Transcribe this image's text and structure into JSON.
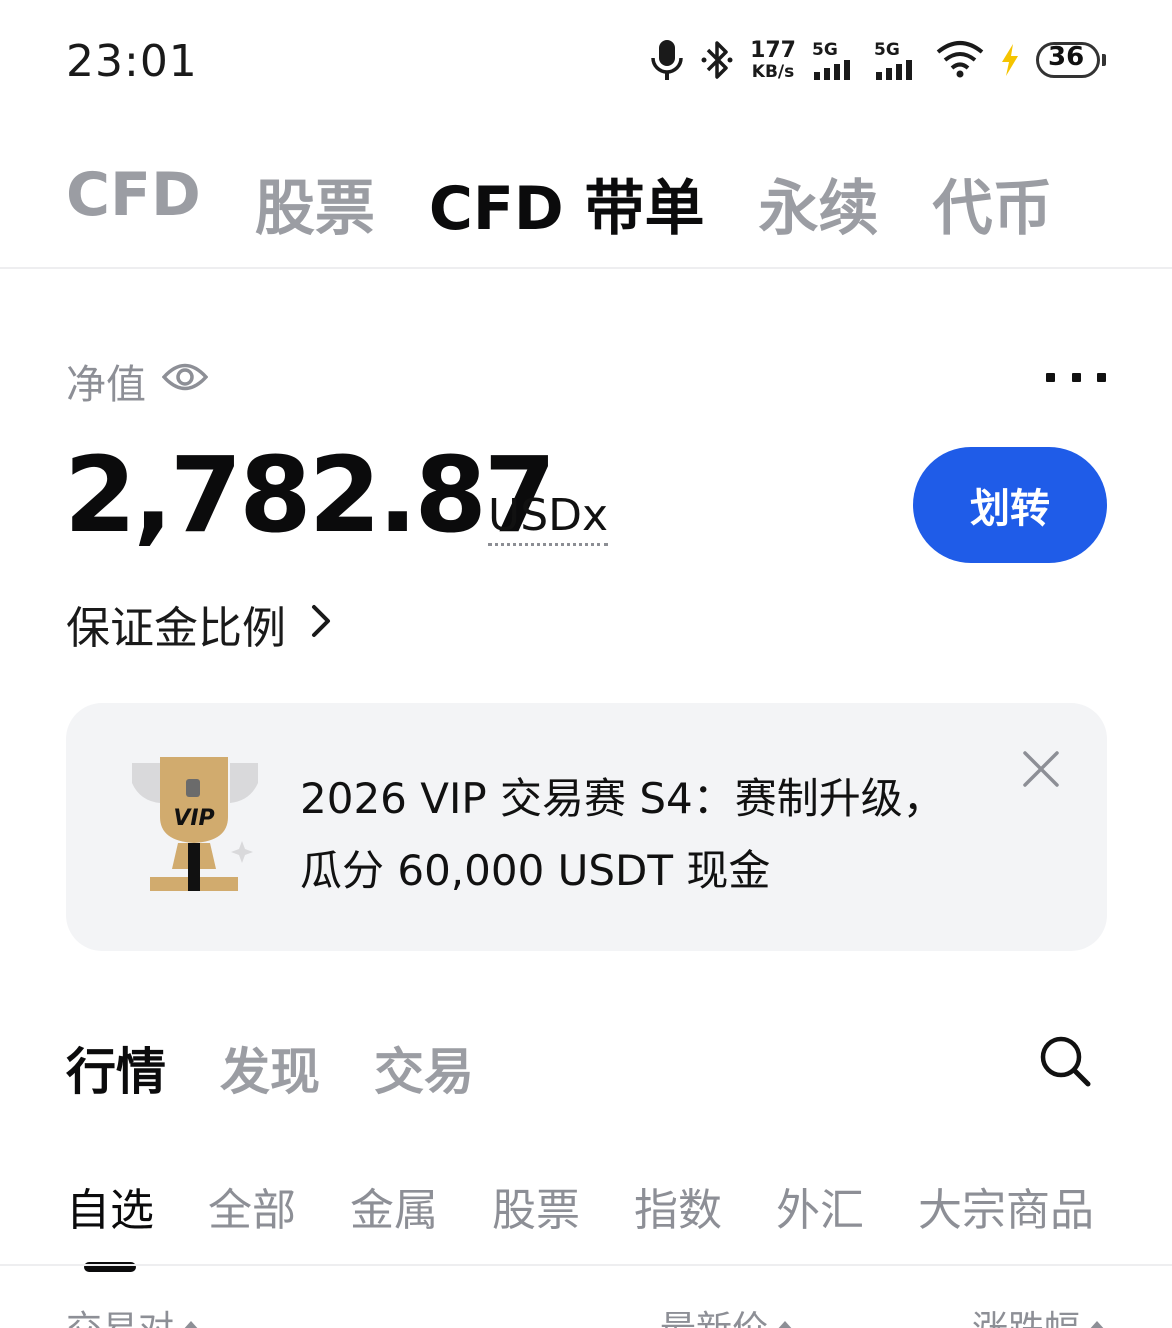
{
  "status_bar": {
    "time": "23:01",
    "net_speed_value": "177",
    "net_speed_unit": "KB/s",
    "signal1_tag": "5G",
    "signal2_tag": "5G",
    "battery_percent": "36",
    "icons": [
      "microphone-icon",
      "bluetooth-icon",
      "signal-icon",
      "wifi-icon",
      "charging-bolt-icon",
      "battery-icon"
    ]
  },
  "top_tabs": [
    {
      "label": "CFD",
      "active": false
    },
    {
      "label": "股票",
      "active": false
    },
    {
      "label": "CFD 带单",
      "active": true
    },
    {
      "label": "永续",
      "active": false
    },
    {
      "label": "代币",
      "active": false
    }
  ],
  "account": {
    "net_value_label": "净值",
    "net_value": "2,782.87",
    "currency": "USDx",
    "transfer_label": "划转",
    "margin_ratio_label": "保证金比例"
  },
  "banner": {
    "text_line1": "2026 VIP 交易赛 S4：赛制升级，",
    "text_line2": "瓜分 60,000 USDT 现金",
    "trophy_badge": "VIP"
  },
  "section_tabs": [
    {
      "label": "行情",
      "active": true
    },
    {
      "label": "发现",
      "active": false
    },
    {
      "label": "交易",
      "active": false
    }
  ],
  "category_tabs": [
    {
      "label": "自选",
      "active": true
    },
    {
      "label": "全部",
      "active": false
    },
    {
      "label": "金属",
      "active": false
    },
    {
      "label": "股票",
      "active": false
    },
    {
      "label": "指数",
      "active": false
    },
    {
      "label": "外汇",
      "active": false
    },
    {
      "label": "大宗商品",
      "active": false
    }
  ],
  "list_header": {
    "pair": "交易对",
    "last_price": "最新价",
    "change": "涨跌幅"
  },
  "colors": {
    "accent": "#1f5ce8",
    "battery": "#2dcc5b",
    "charging": "#f5c400",
    "muted": "#9b9da3"
  }
}
